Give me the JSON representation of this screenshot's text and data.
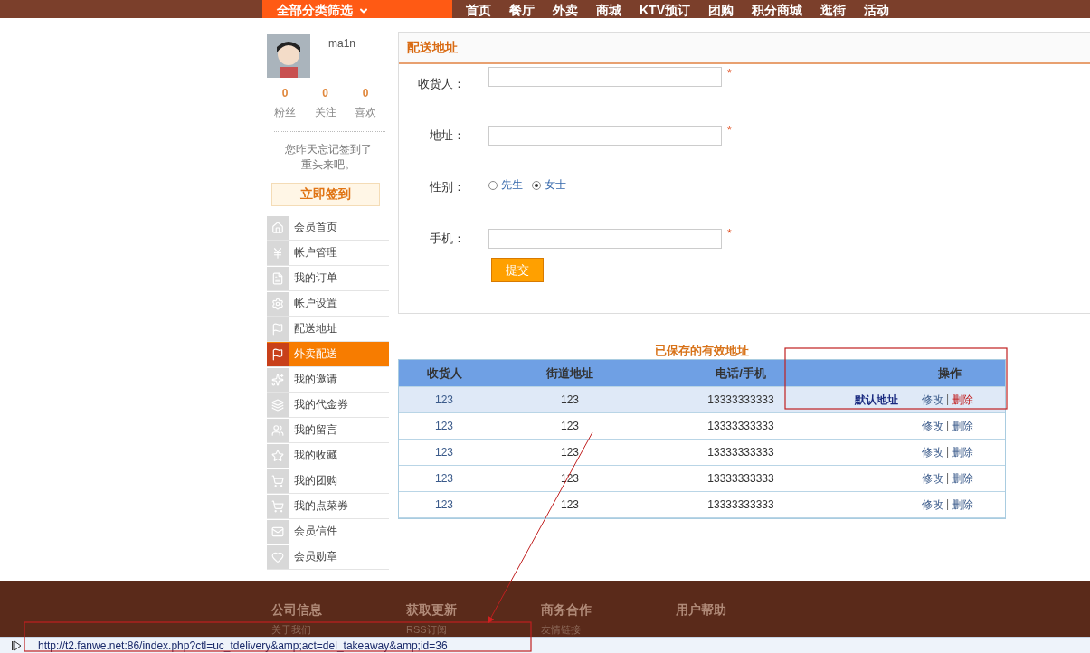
{
  "top_nav": {
    "category_button": "全部分类筛选",
    "items": [
      "首页",
      "餐厅",
      "外卖",
      "商城",
      "KTV预订",
      "团购",
      "积分商城",
      "逛街",
      "活动"
    ]
  },
  "profile": {
    "username": "ma1n",
    "stats": [
      {
        "count": "0",
        "label": "粉丝"
      },
      {
        "count": "0",
        "label": "关注"
      },
      {
        "count": "0",
        "label": "喜欢"
      }
    ],
    "message_lines": [
      "您昨天忘记签到了",
      "重头来吧。"
    ],
    "sign_in_button": "立即签到"
  },
  "sidebar": {
    "items": [
      {
        "label": "会员首页",
        "selected": false
      },
      {
        "label": "帐户管理",
        "selected": false
      },
      {
        "label": "我的订单",
        "selected": false
      },
      {
        "label": "帐户设置",
        "selected": false
      },
      {
        "label": "配送地址",
        "selected": false
      },
      {
        "label": "外卖配送",
        "selected": true
      },
      {
        "label": "我的邀请",
        "selected": false
      },
      {
        "label": "我的代金券",
        "selected": false
      },
      {
        "label": "我的留言",
        "selected": false
      },
      {
        "label": "我的收藏",
        "selected": false
      },
      {
        "label": "我的团购",
        "selected": false
      },
      {
        "label": "我的点菜券",
        "selected": false
      },
      {
        "label": "会员信件",
        "selected": false
      },
      {
        "label": "会员勋章",
        "selected": false
      }
    ]
  },
  "address_form": {
    "title": "配送地址",
    "fields": [
      {
        "kind": "text",
        "label": "收货人：",
        "required_mark": "*"
      },
      {
        "kind": "text",
        "label": "地址：",
        "required_mark": "*"
      },
      {
        "kind": "radio",
        "label": "性别：",
        "options": [
          {
            "label": "先生",
            "selected": false
          },
          {
            "label": "女士",
            "selected": true
          }
        ]
      },
      {
        "kind": "text",
        "label": "手机：",
        "required_mark": "*"
      }
    ],
    "submit_button": "提交"
  },
  "saved_addresses": {
    "title": "已保存的有效地址",
    "columns": [
      "收货人",
      "街道地址",
      "电话/手机",
      "",
      "操作"
    ],
    "rows": [
      {
        "name": "123",
        "street": "123",
        "phone": "13333333333",
        "default_label": "默认地址",
        "edit": "修改",
        "separator": "|",
        "delete": "删除",
        "selected": true
      },
      {
        "name": "123",
        "street": "123",
        "phone": "13333333333",
        "edit": "修改",
        "separator": "|",
        "delete": "删除",
        "selected": false
      },
      {
        "name": "123",
        "street": "123",
        "phone": "13333333333",
        "edit": "修改",
        "separator": "|",
        "delete": "删除",
        "selected": false
      },
      {
        "name": "123",
        "street": "123",
        "phone": "13333333333",
        "edit": "修改",
        "separator": "|",
        "delete": "删除",
        "selected": false
      },
      {
        "name": "123",
        "street": "123",
        "phone": "13333333333",
        "edit": "修改",
        "separator": "|",
        "delete": "删除",
        "selected": false
      }
    ]
  },
  "footer": {
    "columns": [
      {
        "heading": "公司信息",
        "link": "关于我们"
      },
      {
        "heading": "获取更新",
        "link": "RSS订阅"
      },
      {
        "heading": "商务合作",
        "link": "友情链接"
      },
      {
        "heading": "用户帮助"
      }
    ]
  },
  "status_bar": {
    "url": "http://t2.fanwe.net:86/index.php?ctl=uc_tdelivery&amp;act=del_takeaway&amp;id=36"
  }
}
